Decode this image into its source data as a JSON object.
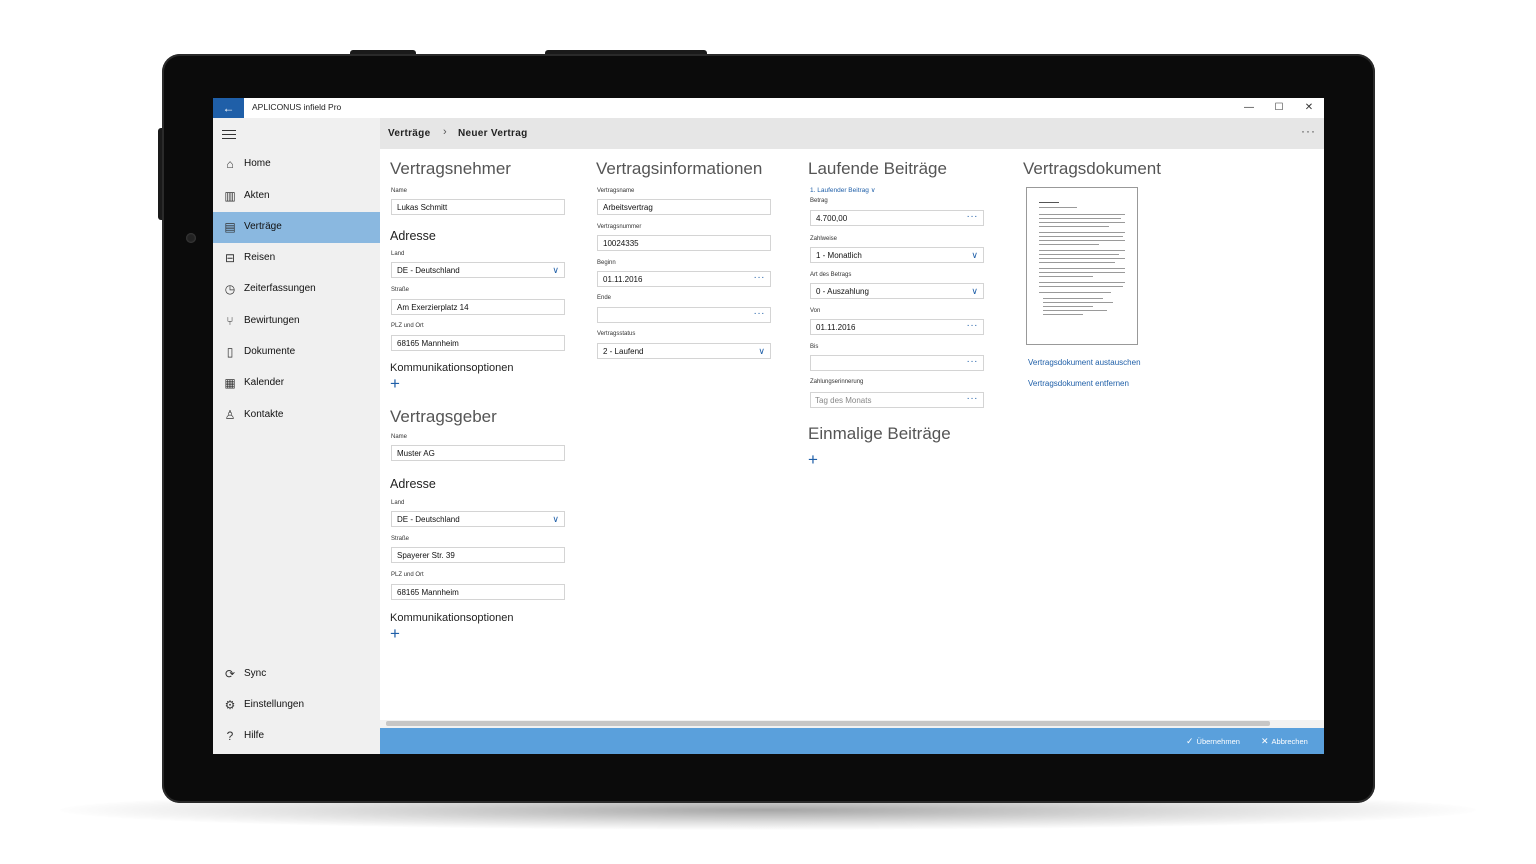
{
  "app": {
    "title": "APLICONUS infield Pro"
  },
  "breadcrumb": {
    "parent": "Verträge",
    "current": "Neuer Vertrag"
  },
  "nav": {
    "items": [
      {
        "label": "Home",
        "icon": "home-icon"
      },
      {
        "label": "Akten",
        "icon": "books-icon"
      },
      {
        "label": "Verträge",
        "icon": "contract-icon",
        "active": true
      },
      {
        "label": "Reisen",
        "icon": "suitcase-icon"
      },
      {
        "label": "Zeiterfassungen",
        "icon": "clock-icon"
      },
      {
        "label": "Bewirtungen",
        "icon": "cutlery-icon"
      },
      {
        "label": "Dokumente",
        "icon": "document-icon"
      },
      {
        "label": "Kalender",
        "icon": "calendar-icon"
      },
      {
        "label": "Kontakte",
        "icon": "person-icon"
      }
    ],
    "bottom": [
      {
        "label": "Sync",
        "icon": "sync-icon"
      },
      {
        "label": "Einstellungen",
        "icon": "gear-icon"
      },
      {
        "label": "Hilfe",
        "icon": "help-icon"
      }
    ]
  },
  "vertragsnehmer": {
    "title": "Vertragsnehmer",
    "name_label": "Name",
    "name": "Lukas Schmitt",
    "address_title": "Adresse",
    "land_label": "Land",
    "land": "DE - Deutschland",
    "strasse_label": "Straße",
    "strasse": "Am Exerzierplatz 14",
    "plz_label": "PLZ und Ort",
    "plz": "68165 Mannheim",
    "komm_title": "Kommunikationsoptionen"
  },
  "vertragsgeber": {
    "title": "Vertragsgeber",
    "name_label": "Name",
    "name": "Muster AG",
    "address_title": "Adresse",
    "land_label": "Land",
    "land": "DE - Deutschland",
    "strasse_label": "Straße",
    "strasse": "Spayerer Str. 39",
    "plz_label": "PLZ und Ort",
    "plz": "68165 Mannheim",
    "komm_title": "Kommunikationsoptionen"
  },
  "vertragsinfo": {
    "title": "Vertragsinformationen",
    "name_label": "Vertragsname",
    "name": "Arbeitsvertrag",
    "nummer_label": "Vertragsnummer",
    "nummer": "10024335",
    "beginn_label": "Beginn",
    "beginn": "01.11.2016",
    "ende_label": "Ende",
    "ende": "",
    "status_label": "Vertragsstatus",
    "status": "2 - Laufend"
  },
  "laufende": {
    "title": "Laufende Beiträge",
    "selector": "1. Laufender Beitrag",
    "betrag_label": "Betrag",
    "betrag": "4.700,00",
    "zahlweise_label": "Zahlweise",
    "zahlweise": "1 - Monatlich",
    "art_label": "Art des Betrags",
    "art": "0 - Auszahlung",
    "von_label": "Von",
    "von": "01.11.2016",
    "bis_label": "Bis",
    "bis": "",
    "erinnerung_label": "Zahlungserinnerung",
    "erinnerung_placeholder": "Tag des Monats"
  },
  "einmalige": {
    "title": "Einmalige Beiträge"
  },
  "dokument": {
    "title": "Vertragsdokument",
    "replace_link": "Vertragsdokument austauschen",
    "remove_link": "Vertragsdokument entfernen"
  },
  "actions": {
    "apply": "Übernehmen",
    "cancel": "Abbrechen"
  }
}
